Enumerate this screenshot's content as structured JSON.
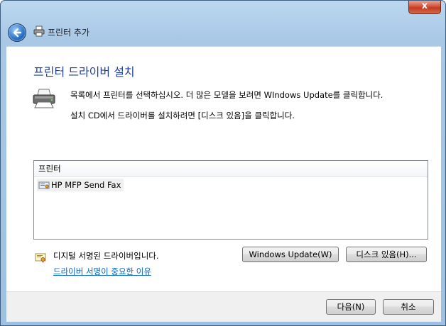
{
  "window": {
    "close_glyph": "x",
    "nav_title": "프린터 추가"
  },
  "main": {
    "heading": "프린터 드라이버 설치",
    "instruction1": "목록에서 프린터를 선택하십시오. 더 많은 모델을 보려면 WIndows Update를 클릭합니다.",
    "instruction2": "설치 CD에서 드라이버를 설치하려면 [디스크 있음]을 클릭합니다."
  },
  "printer_list": {
    "header": "프린터",
    "items": [
      "HP MFP Send Fax"
    ]
  },
  "signature": {
    "status_text": "디지털 서명된 드라이버입니다.",
    "link_text": "드라이버 서명이 중요한 이유"
  },
  "buttons": {
    "windows_update": "Windows Update(W)",
    "have_disk": "디스크 있음(H)...",
    "next": "다음(N)",
    "cancel": "취소"
  },
  "icons": {
    "back": "back-arrow-icon",
    "printer": "printer-icon",
    "certificate": "certificate-icon"
  },
  "colors": {
    "heading": "#1f3f9b",
    "link": "#0066cc",
    "close_button": "#c23a20"
  }
}
